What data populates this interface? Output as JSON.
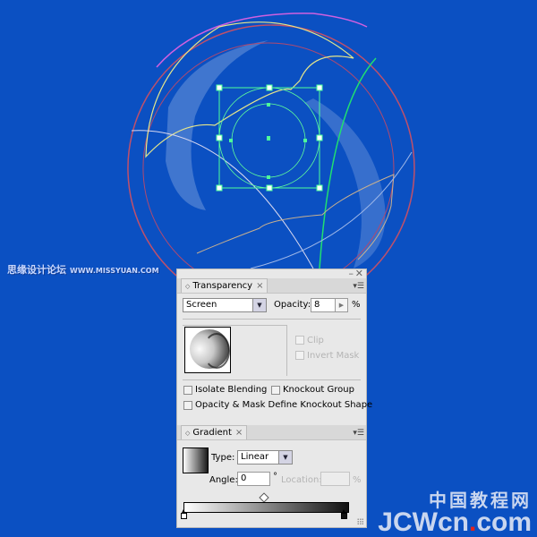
{
  "canvas": {
    "background_color": "#0b50c2",
    "selection_color": "#4dff9a",
    "watermarks": {
      "top_left_cn": "思缘设计论坛",
      "top_left_url": "WWW.MISSYUAN.COM",
      "bottom_right_cn": "中国教程网",
      "bottom_right_en_a": "JCWcn",
      "bottom_right_en_dot": ".",
      "bottom_right_en_b": "com"
    }
  },
  "panel_controls": {
    "minimize_icon": "–",
    "close_icon": "✕"
  },
  "transparency": {
    "tab_arrows": "◇",
    "tab_label": "Transparency",
    "tab_close": "×",
    "menu_icon": "▾☰",
    "blend_mode": "Screen",
    "opacity_label": "Opacity:",
    "opacity_value": "8",
    "opacity_unit": "%",
    "clip_label": "Clip",
    "invert_mask_label": "Invert Mask",
    "isolate_blending_label": "Isolate Blending",
    "knockout_group_label": "Knockout Group",
    "opacity_mask_knockout_label": "Opacity & Mask Define Knockout Shape",
    "clip_checked": false,
    "invert_mask_checked": false,
    "isolate_blending_checked": false,
    "knockout_group_checked": false,
    "opacity_mask_knockout_checked": false
  },
  "gradient": {
    "tab_arrows": "◇",
    "tab_label": "Gradient",
    "tab_close": "×",
    "menu_icon": "▾☰",
    "type_label": "Type:",
    "type_value": "Linear",
    "angle_label": "Angle:",
    "angle_value": "0",
    "angle_unit": "°",
    "location_label": "Location:",
    "location_value": "",
    "location_unit": "%",
    "stops": [
      {
        "color": "#ffffff",
        "position_percent": 0
      },
      {
        "color": "#111111",
        "position_percent": 100
      }
    ],
    "midpoint_percent": 50
  }
}
